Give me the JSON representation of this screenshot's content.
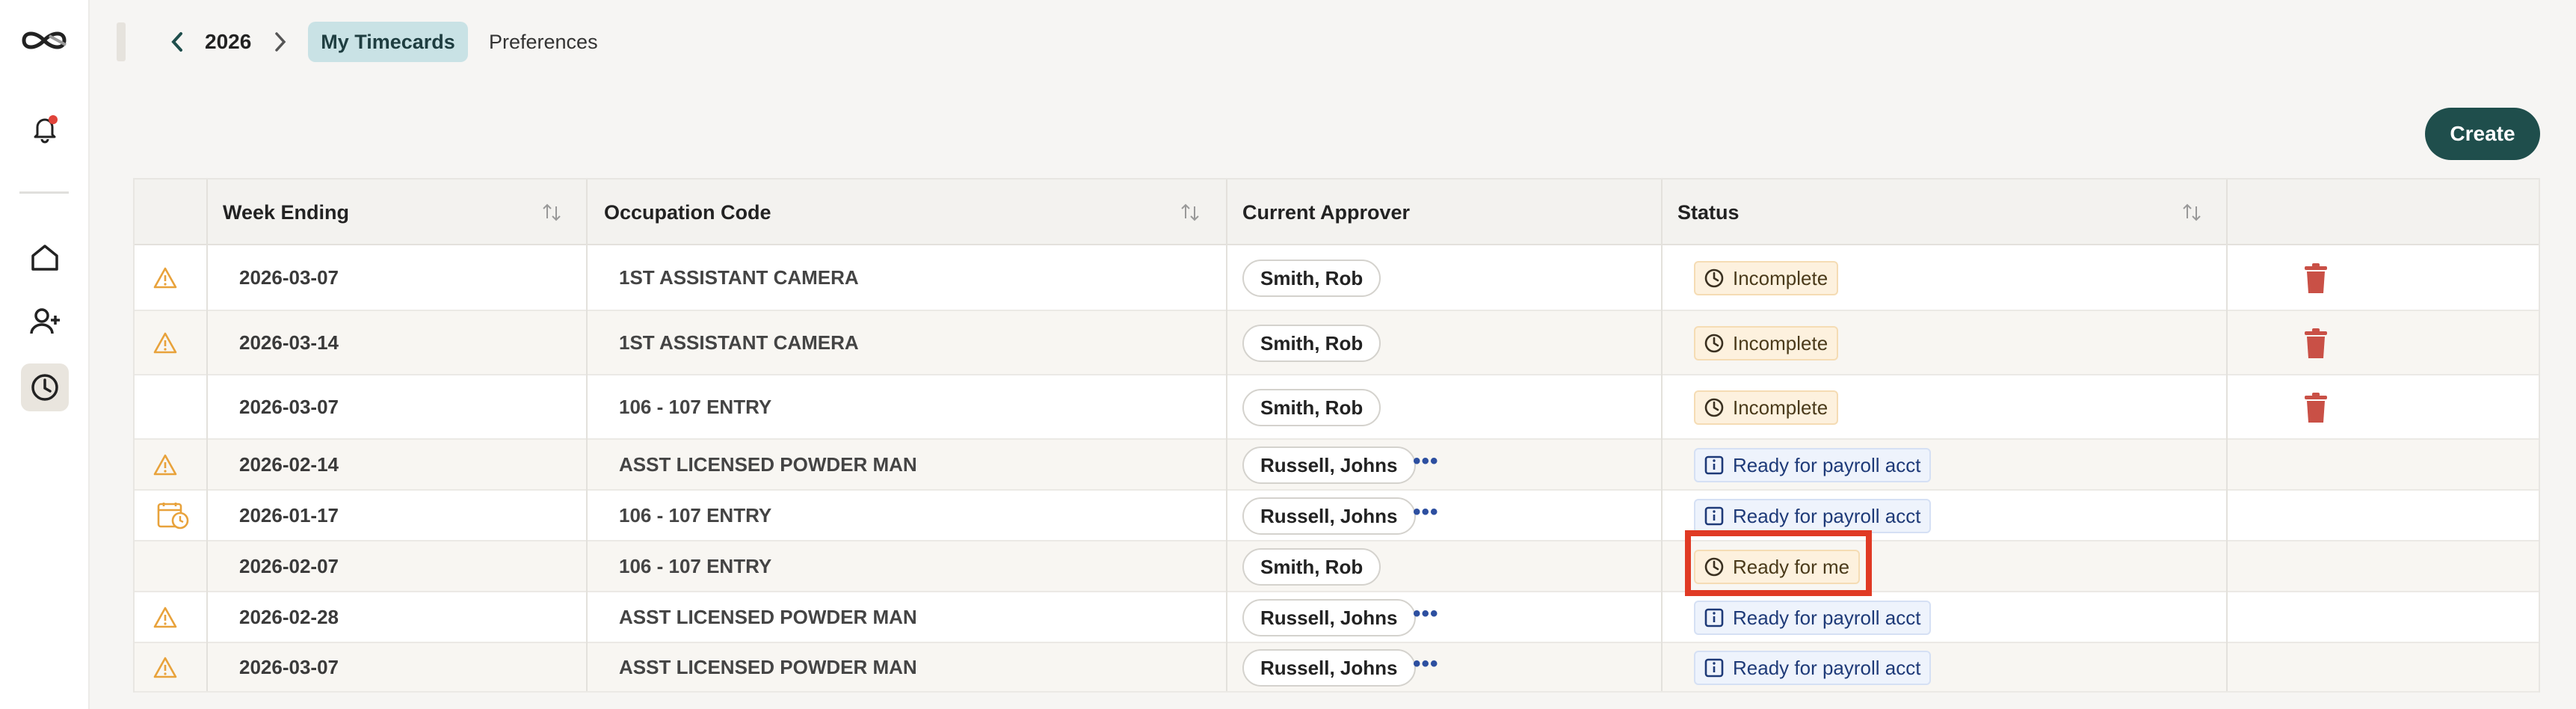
{
  "colors": {
    "accent": "#1f4e4c",
    "highlight": "#e03a24",
    "trash": "#c95046",
    "warn": "#e8a23b",
    "info": "#2d4fa0"
  },
  "sidebar": {
    "logo_icon": "infinity-logo",
    "items": [
      {
        "name": "notifications",
        "icon": "bell-icon",
        "has_dot": true
      },
      {
        "name": "home",
        "icon": "home-icon"
      },
      {
        "name": "add-user",
        "icon": "add-user-icon"
      },
      {
        "name": "timecards",
        "icon": "clock-icon",
        "active": true
      }
    ]
  },
  "topbar": {
    "year": "2026",
    "tab_active": "My Timecards",
    "tab_preferences": "Preferences"
  },
  "create_label": "Create",
  "table": {
    "headers": {
      "week_ending": "Week Ending",
      "occupation_code": "Occupation Code",
      "current_approver": "Current Approver",
      "status": "Status"
    },
    "rows": [
      {
        "icon": "warning",
        "week_ending": "2026-03-07",
        "occupation": "1ST ASSISTANT CAMERA",
        "approver": "Smith, Rob",
        "more": false,
        "status": "Incomplete",
        "status_type": "warn",
        "deletable": true
      },
      {
        "icon": "warning",
        "week_ending": "2026-03-14",
        "occupation": "1ST ASSISTANT CAMERA",
        "approver": "Smith, Rob",
        "more": false,
        "status": "Incomplete",
        "status_type": "warn",
        "deletable": true
      },
      {
        "icon": "",
        "week_ending": "2026-03-07",
        "occupation": "106 - 107 ENTRY",
        "approver": "Smith, Rob",
        "more": false,
        "status": "Incomplete",
        "status_type": "warn",
        "deletable": true
      },
      {
        "icon": "warning",
        "week_ending": "2026-02-14",
        "occupation": "ASST LICENSED POWDER MAN",
        "approver": "Russell, Johns",
        "more": true,
        "status": "Ready for payroll acct",
        "status_type": "info",
        "deletable": false
      },
      {
        "icon": "calendar-clock",
        "week_ending": "2026-01-17",
        "occupation": "106 - 107 ENTRY",
        "approver": "Russell, Johns",
        "more": true,
        "status": "Ready for payroll acct",
        "status_type": "info",
        "deletable": false
      },
      {
        "icon": "",
        "week_ending": "2026-02-07",
        "occupation": "106 - 107 ENTRY",
        "approver": "Smith, Rob",
        "more": false,
        "status": "Ready for me",
        "status_type": "warn",
        "deletable": false
      },
      {
        "icon": "warning",
        "week_ending": "2026-02-28",
        "occupation": "ASST LICENSED POWDER MAN",
        "approver": "Russell, Johns",
        "more": true,
        "status": "Ready for payroll acct",
        "status_type": "info",
        "deletable": false
      },
      {
        "icon": "warning",
        "week_ending": "2026-03-07",
        "occupation": "ASST LICENSED POWDER MAN",
        "approver": "Russell, Johns",
        "more": true,
        "status": "Ready for payroll acct",
        "status_type": "info",
        "deletable": false
      }
    ]
  }
}
